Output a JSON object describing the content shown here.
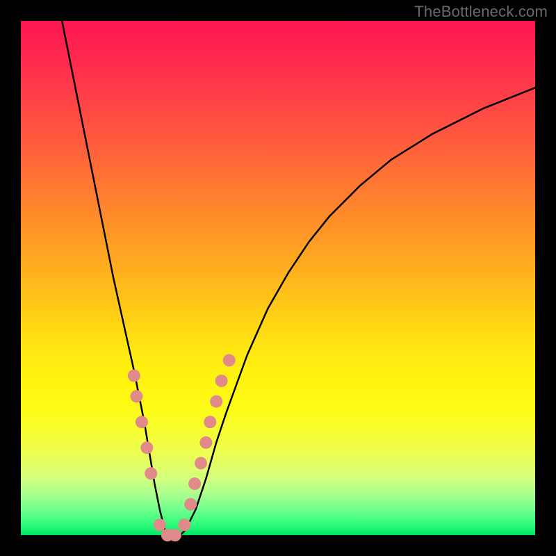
{
  "watermark": {
    "text": "TheBottleneck.com"
  },
  "chart_data": {
    "type": "line",
    "title": "",
    "xlabel": "",
    "ylabel": "",
    "xlim": [
      0,
      100
    ],
    "ylim": [
      0,
      100
    ],
    "grid": false,
    "legend": false,
    "background_gradient": {
      "stops": [
        {
          "pos": 0.0,
          "color": "#ff1553"
        },
        {
          "pos": 0.5,
          "color": "#ffc317"
        },
        {
          "pos": 0.78,
          "color": "#fdfd20"
        },
        {
          "pos": 1.0,
          "color": "#00e765"
        }
      ]
    },
    "series": [
      {
        "name": "bottleneck-curve",
        "color": "#000000",
        "x": [
          8,
          10,
          12,
          14,
          16,
          18,
          20,
          22,
          24,
          25,
          26,
          27,
          28,
          29,
          30,
          31,
          32,
          34,
          36,
          38,
          40,
          44,
          48,
          52,
          56,
          60,
          66,
          72,
          80,
          90,
          100
        ],
        "y": [
          100,
          90,
          80,
          70,
          60,
          50,
          41,
          32,
          22,
          16,
          10,
          5,
          1,
          0,
          0,
          0,
          1,
          5,
          11,
          18,
          24,
          35,
          44,
          51,
          57,
          62,
          68,
          73,
          78,
          83,
          87
        ]
      },
      {
        "name": "highlight-dots",
        "color": "#e08a8a",
        "marker": "circle",
        "x": [
          22.0,
          22.5,
          23.5,
          24.5,
          25.3,
          27.0,
          28.5,
          30.0,
          31.8,
          33.0,
          33.8,
          35.0,
          36.0,
          36.8,
          38.0,
          39.0,
          40.5
        ],
        "y": [
          31,
          27,
          22,
          17,
          12,
          2,
          0,
          0,
          2,
          6,
          10,
          14,
          18,
          22,
          26,
          30,
          34
        ]
      }
    ]
  }
}
